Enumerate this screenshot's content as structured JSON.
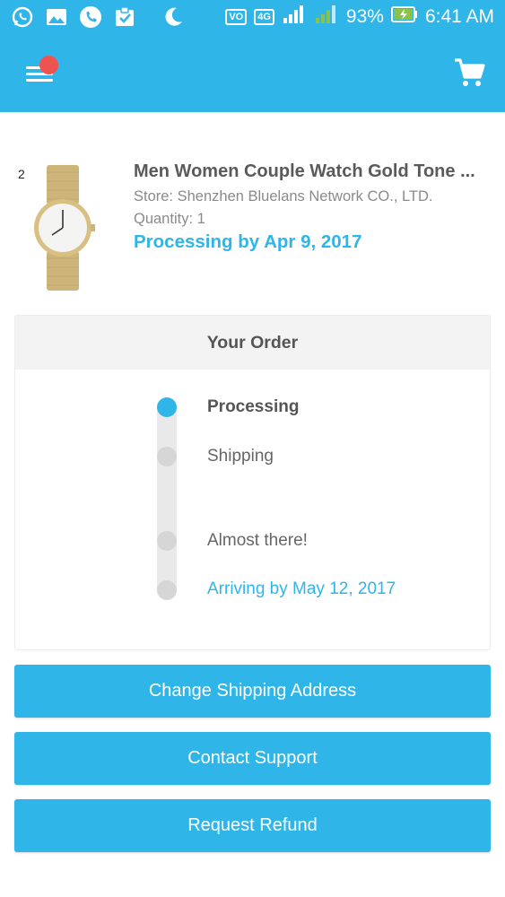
{
  "status_bar": {
    "network_badge": "4G",
    "volte_badge": "VO",
    "battery": "93%",
    "time": "6:41 AM"
  },
  "colors": {
    "accent": "#2fb5e8",
    "badge": "#ef5350"
  },
  "product": {
    "index": "2",
    "title": "Men Women Couple Watch Gold Tone ...",
    "store": "Store: Shenzhen Bluelans Network CO., LTD.",
    "quantity": "Quantity: 1",
    "processing": "Processing by Apr 9, 2017"
  },
  "order": {
    "header": "Your Order",
    "steps": [
      {
        "label": "Processing"
      },
      {
        "label": "Shipping"
      },
      {
        "label": "Almost there!"
      },
      {
        "label": "Arriving by May 12, 2017"
      }
    ]
  },
  "actions": {
    "change_address": "Change Shipping Address",
    "contact_support": "Contact Support",
    "request_refund": "Request Refund"
  }
}
